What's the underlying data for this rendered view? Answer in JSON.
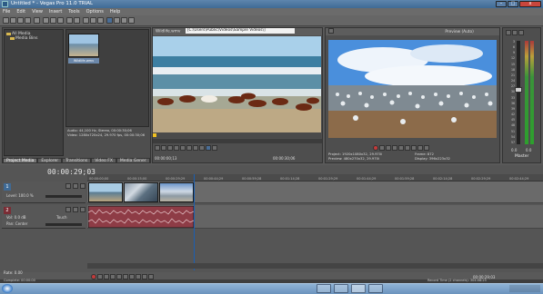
{
  "window": {
    "title": "Untitled * - Vegas Pro 11.0 TRIAL",
    "minimize": "–",
    "maximize": "□",
    "close": "x"
  },
  "menu": [
    "File",
    "Edit",
    "View",
    "Insert",
    "Tools",
    "Options",
    "Help"
  ],
  "media_tree": {
    "items": [
      "All Media",
      "Media Bins"
    ]
  },
  "media_thumb": {
    "label": "Wildlife.wmv"
  },
  "media_info": {
    "audio": "Audio: 44,100 Hz, Stereo, 00:00:30;06",
    "video": "Video: 1280x720x24, 29.970 fps, 00:00:30;06"
  },
  "left_tabs": [
    "Project Media",
    "Explorer",
    "Transitions",
    "Video FX",
    "Media Gener"
  ],
  "trimmer": {
    "file": "Wildlife.wmv",
    "path": "[C:\\Users\\Public\\Videos\\Sample Videos\\]",
    "timecode": "00:00:00;13",
    "end_time": "00:00:30;06"
  },
  "preview": {
    "title": "Preview (Auto)",
    "project_label": "Project:",
    "project_value": "1920x1080x32, 29.970i",
    "frame_label": "Frame:",
    "frame_value": "872",
    "preview_label": "Preview:",
    "preview_value": "480x270x32, 29.970i",
    "display_label": "Display:",
    "display_value": "396x223x32"
  },
  "master": {
    "title": "Master",
    "scale": [
      "3",
      "6",
      "9",
      "12",
      "15",
      "18",
      "21",
      "24",
      "27",
      "30",
      "33",
      "36",
      "39",
      "42",
      "45",
      "48",
      "51",
      "54",
      "57"
    ],
    "level_l": "0.0",
    "level_r": "0.0"
  },
  "timeline": {
    "timecode": "00:00:29;03",
    "ruler": [
      "00:00:00;00",
      "00:00:15;00",
      "00:00:29;29",
      "00:00:44;29",
      "00:00:59;28",
      "00:01:14;28",
      "00:01:29;29",
      "00:01:44;29",
      "00:01:59;28",
      "00:02:14;28",
      "00:02:29;29",
      "00:02:44;29"
    ],
    "video_track": {
      "number": "1",
      "level_label": "Level:",
      "level_value": "100.0 %"
    },
    "audio_track": {
      "number": "2",
      "vol_label": "Vol:",
      "vol_value": "0.0 dB",
      "touch": "Touch",
      "pan_label": "Pan:",
      "pan_value": "Center"
    }
  },
  "status": {
    "rate": "Rate: 0.00",
    "complete": "Complete: 00:00:00",
    "record_time": "Record Time (2 channels): 304:08:25",
    "transport_time": "00:00:29;03"
  },
  "colors": {
    "accent": "#3f6a95",
    "audio_clip": "#8e3c46",
    "video_clip": "#6f8fae",
    "cursor": "#1a5fb4"
  },
  "icons": [
    "vegas-logo-icon",
    "folder-icon",
    "play-icon",
    "stop-icon",
    "record-icon",
    "loop-icon",
    "rewind-icon",
    "forward-icon",
    "start-windows-icon"
  ]
}
